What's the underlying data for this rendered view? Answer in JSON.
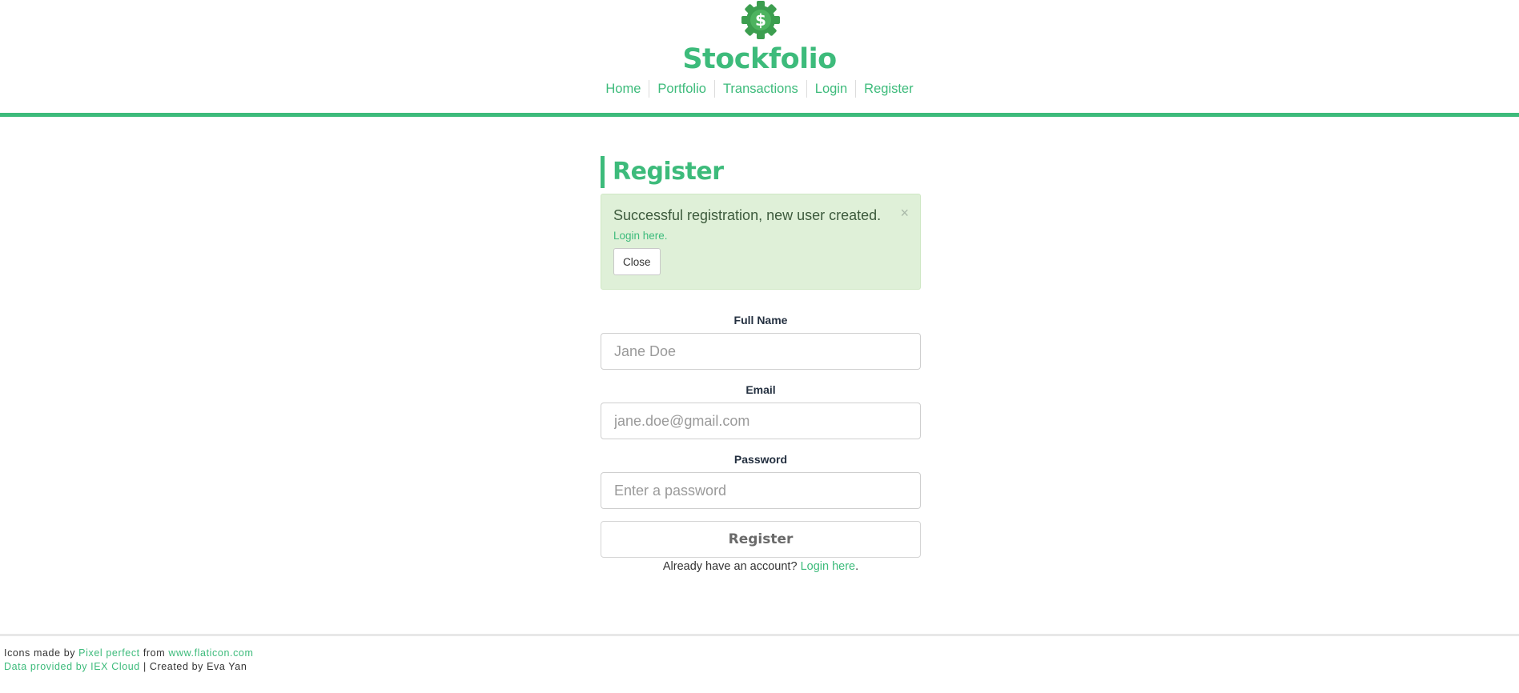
{
  "header": {
    "brand": "Stockfolio",
    "logo_icon": "dollar-gear-icon",
    "logo_symbol": "$",
    "accent_color": "#3dbb7b",
    "nav": [
      {
        "label": "Home"
      },
      {
        "label": "Portfolio"
      },
      {
        "label": "Transactions"
      },
      {
        "label": "Login"
      },
      {
        "label": "Register"
      }
    ]
  },
  "main": {
    "title": "Register",
    "alert": {
      "message": "Successful registration, new user created.",
      "dismiss_symbol": "×",
      "link_text": "Login here.",
      "close_label": "Close",
      "background_color": "#dff0d8"
    },
    "form": {
      "full_name": {
        "label": "Full Name",
        "placeholder": "Jane Doe",
        "value": ""
      },
      "email": {
        "label": "Email",
        "placeholder": "jane.doe@gmail.com",
        "value": ""
      },
      "password": {
        "label": "Password",
        "placeholder": "Enter a password",
        "value": ""
      },
      "submit_label": "Register"
    },
    "login_prompt": {
      "text": "Already have an account?",
      "link_text": "Login here",
      "suffix": "."
    }
  },
  "footer": {
    "line1": {
      "prefix": "Icons made by",
      "author_link": "Pixel perfect",
      "middle": "from",
      "site_link": "www.flaticon.com"
    },
    "line2": {
      "data_link": "Data provided by IEX Cloud",
      "suffix": "| Created by Eva Yan"
    }
  }
}
